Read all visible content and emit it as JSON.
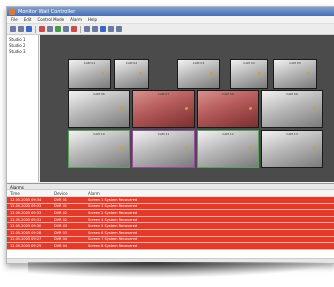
{
  "window": {
    "title": "Monitor Wall Controller"
  },
  "menu": [
    "File",
    "Edit",
    "Control Mode",
    "Alarm",
    "Help"
  ],
  "toolbar": {
    "buttons": [
      "new-icon",
      "open-icon",
      "save-icon",
      "record-icon",
      "stop-icon",
      "play-icon",
      "camera-icon",
      "alarm-icon",
      "zoom-in-icon",
      "zoom-out-icon",
      "layout-icon",
      "settings-icon",
      "help-icon"
    ]
  },
  "sidebar": {
    "items": [
      "Studio 1",
      "Studio 2",
      "Studio 3"
    ]
  },
  "wall": {
    "screens": [
      {
        "label": "CAM 01",
        "state": "normal"
      },
      {
        "label": "CAM 02",
        "state": "normal"
      },
      {
        "label": "CAM 03",
        "state": "normal"
      },
      {
        "label": "CAM 04",
        "state": "normal"
      },
      {
        "label": "CAM 05",
        "state": "normal"
      },
      {
        "label": "CAM 06",
        "state": "normal"
      },
      {
        "label": "CAM 07",
        "state": "alarm"
      },
      {
        "label": "CAM 08",
        "state": "alarm"
      },
      {
        "label": "CAM 09",
        "state": "normal"
      },
      {
        "label": "CAM 10",
        "state": "normal"
      },
      {
        "label": "CAM 11",
        "state": "selected"
      },
      {
        "label": "CAM 12",
        "state": "normal"
      },
      {
        "label": "CAM 13",
        "state": "normal"
      }
    ]
  },
  "alarms": {
    "title": "Alarms",
    "columns": [
      "Time",
      "Device",
      "Alarm"
    ],
    "rows": [
      {
        "time": "12.05.2005 09:34",
        "device": "DVR 01",
        "alarm": "Screen 1 System Recovered"
      },
      {
        "time": "12.05.2005 09:33",
        "device": "DVR 01",
        "alarm": "Screen 3 System Recovered"
      },
      {
        "time": "12.05.2005 09:33",
        "device": "DVR 02",
        "alarm": "Screen 2 System Recovered"
      },
      {
        "time": "12.05.2005 09:31",
        "device": "DVR 02",
        "alarm": "Screen 4 System Recovered"
      },
      {
        "time": "12.05.2005 09:30",
        "device": "DVR 03",
        "alarm": "Screen 5 System Recovered"
      },
      {
        "time": "12.05.2005 09:28",
        "device": "DVR 03",
        "alarm": "Screen 6 System Recovered"
      },
      {
        "time": "12.05.2005 09:27",
        "device": "DVR 04",
        "alarm": "Screen 7 System Recovered"
      },
      {
        "time": "12.05.2005 09:25",
        "device": "DVR 04",
        "alarm": "Screen 8 System Recovered"
      }
    ]
  },
  "colors": {
    "alarm_row": "#e23b2a",
    "wall_bg": "#4b4b4b",
    "alarm_screen": "#b55a5a"
  }
}
